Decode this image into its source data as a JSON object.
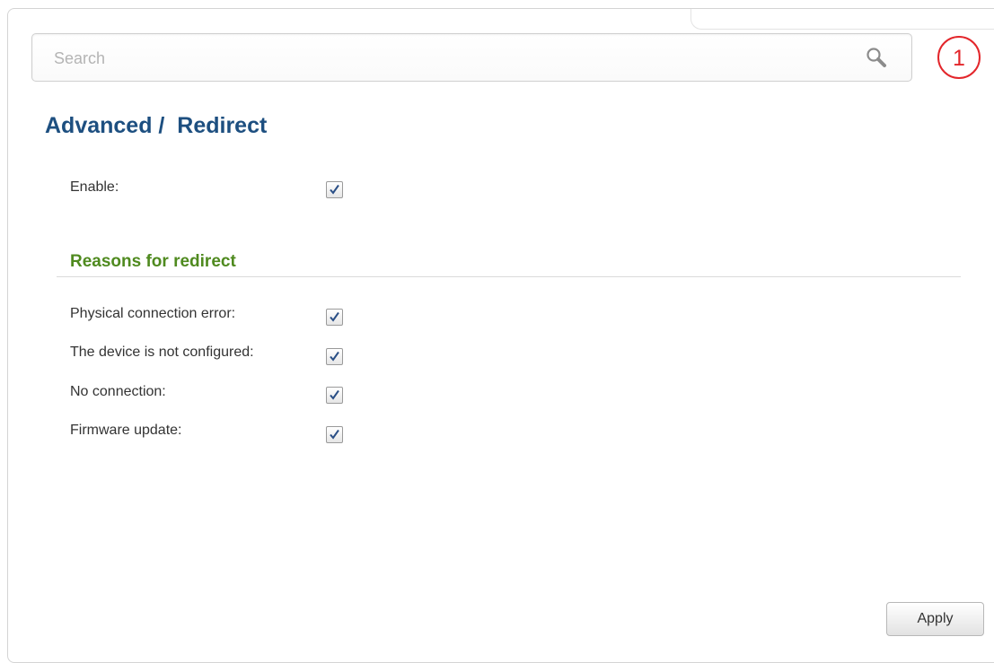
{
  "search": {
    "placeholder": "Search",
    "value": ""
  },
  "notification_badge": {
    "count": "1",
    "color": "#e3262b"
  },
  "page": {
    "title": "Advanced /  Redirect"
  },
  "enable": {
    "label": "Enable:",
    "checked": true
  },
  "reasons_section": {
    "title": "Reasons for redirect",
    "items": [
      {
        "label": "Physical connection error:",
        "checked": true
      },
      {
        "label": "The device is not configured:",
        "checked": true
      },
      {
        "label": "No connection:",
        "checked": true
      },
      {
        "label": "Firmware update:",
        "checked": true
      }
    ]
  },
  "actions": {
    "apply_label": "Apply"
  },
  "colors": {
    "title": "#1d4f80",
    "section_title": "#4f8a1f",
    "checkmark": "#2a4f86"
  },
  "icons": {
    "search": "search-icon",
    "checkmark": "checkmark-icon"
  }
}
